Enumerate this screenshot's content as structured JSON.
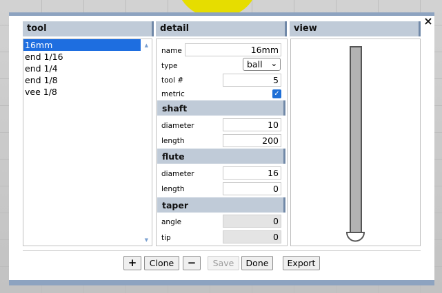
{
  "panels": {
    "tool_title": "tool",
    "detail_title": "detail",
    "view_title": "view"
  },
  "tools": [
    "16mm",
    "end 1/16",
    "end 1/4",
    "end 1/8",
    "vee 1/8"
  ],
  "selected_tool": "16mm",
  "detail": {
    "name_label": "name",
    "name_value": "16mm",
    "type_label": "type",
    "type_value": "ball",
    "tool_number_label": "tool #",
    "tool_number_value": "5",
    "metric_label": "metric",
    "metric_checked": true
  },
  "sections": {
    "shaft": {
      "title": "shaft",
      "diameter_label": "diameter",
      "diameter_value": "10",
      "length_label": "length",
      "length_value": "200"
    },
    "flute": {
      "title": "flute",
      "diameter_label": "diameter",
      "diameter_value": "16",
      "length_label": "length",
      "length_value": "0"
    },
    "taper": {
      "title": "taper",
      "angle_label": "angle",
      "angle_value": "0",
      "tip_label": "tip",
      "tip_value": "0"
    }
  },
  "buttons": {
    "add": "+",
    "clone": "Clone",
    "remove": "−",
    "save": "Save",
    "done": "Done",
    "export": "Export"
  },
  "icons": {
    "close": "×",
    "scroll_up": "▲",
    "scroll_down": "▼",
    "check": "✓",
    "chevron": "⌄"
  },
  "colors": {
    "header_bg": "#c0cbd8",
    "header_accent": "#7189a8",
    "selection": "#1e6ee0",
    "tool_preview": "#b3b3b3"
  }
}
